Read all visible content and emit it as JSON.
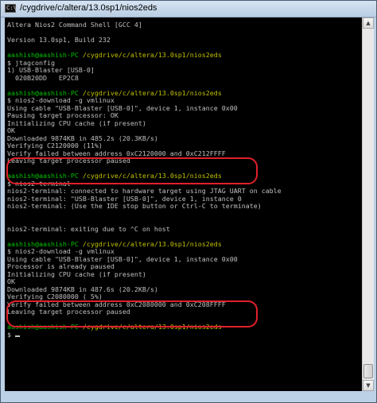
{
  "window": {
    "title": "/cygdrive/c/altera/13.0sp1/nios2eds",
    "icon": "console-window-icon",
    "icon_text": "C:\\"
  },
  "terminal": {
    "lines": [
      {
        "text": "Altera Nios2 Command Shell [GCC 4]"
      },
      {
        "text": ""
      },
      {
        "text": "Version 13.0sp1, Build 232"
      },
      {
        "text": ""
      },
      {
        "user": "aashish@aashish-PC",
        "path": "/cygdrive/c/altera/13.0sp1/nios2eds"
      },
      {
        "text": "$ jtagconfig"
      },
      {
        "text": "1) USB-Blaster [USB-0]"
      },
      {
        "text": "  020B20DD   EP2C8"
      },
      {
        "text": ""
      },
      {
        "user": "aashish@aashish-PC",
        "path": "/cygdrive/c/altera/13.0sp1/nios2eds"
      },
      {
        "text": "$ nios2-download -g vmlinux"
      },
      {
        "text": "Using cable \"USB-Blaster [USB-0]\", device 1, instance 0x00"
      },
      {
        "text": "Pausing target processor: OK"
      },
      {
        "text": "Initializing CPU cache (if present)"
      },
      {
        "text": "OK"
      },
      {
        "text": "Downloaded 9874KB in 485.2s (20.3KB/s)"
      },
      {
        "text": "Verifying C2120000 (11%)"
      },
      {
        "text": "Verify failed between address 0xC2120000 and 0xC212FFFF"
      },
      {
        "text": "Leaving target processor paused"
      },
      {
        "text": ""
      },
      {
        "user": "aashish@aashish-PC",
        "path": "/cygdrive/c/altera/13.0sp1/nios2eds"
      },
      {
        "text": "$ nios2-terminal"
      },
      {
        "text": "nios2-terminal: connected to hardware target using JTAG UART on cable"
      },
      {
        "text": "nios2-terminal: \"USB-Blaster [USB-0]\", device 1, instance 0"
      },
      {
        "text": "nios2-terminal: (Use the IDE stop button or Ctrl-C to terminate)"
      },
      {
        "text": ""
      },
      {
        "text": ""
      },
      {
        "text": "nios2-terminal: exiting due to ^C on host"
      },
      {
        "text": ""
      },
      {
        "user": "aashish@aashish-PC",
        "path": "/cygdrive/c/altera/13.0sp1/nios2eds"
      },
      {
        "text": "$ nios2-download -g vmlinux"
      },
      {
        "text": "Using cable \"USB-Blaster [USB-0]\", device 1, instance 0x00"
      },
      {
        "text": "Processor is already paused"
      },
      {
        "text": "Initializing CPU cache (if present)"
      },
      {
        "text": "OK"
      },
      {
        "text": "Downloaded 9874KB in 487.6s (20.2KB/s)"
      },
      {
        "text": "Verifying C2080000 ( 5%)"
      },
      {
        "text": "Verify failed between address 0xC2080000 and 0xC208FFFF"
      },
      {
        "text": "Leaving target processor paused"
      },
      {
        "text": ""
      },
      {
        "user": "aashish@aashish-PC",
        "path": "/cygdrive/c/altera/13.0sp1/nios2eds"
      },
      {
        "text": "$ ",
        "cursor": true
      }
    ]
  },
  "scrollbar": {
    "up_icon": "scroll-up-arrow-icon",
    "down_icon": "scroll-down-arrow-icon",
    "up_glyph": "▲",
    "down_glyph": "▼"
  },
  "annotations": {
    "highlight_color": "#e0202a"
  }
}
